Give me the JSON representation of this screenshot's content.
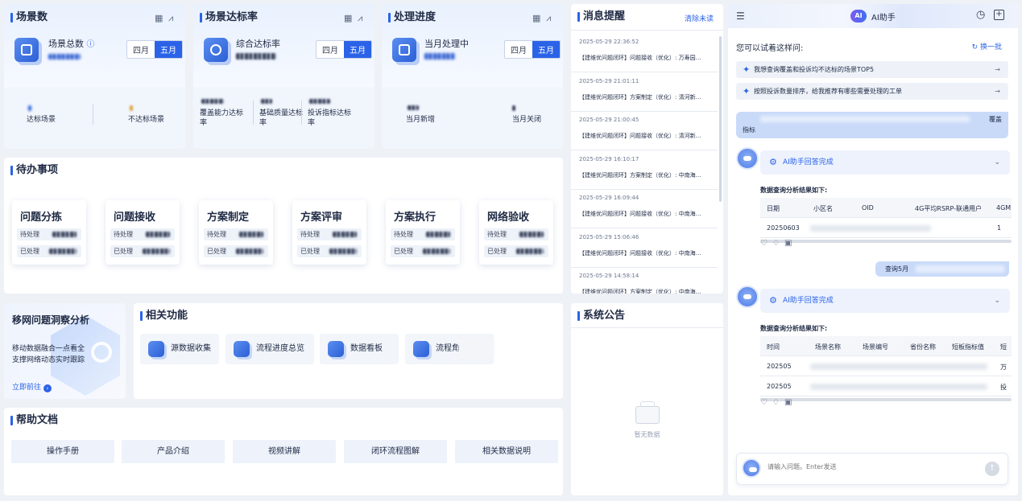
{
  "cards": {
    "scene": {
      "title": "场景数",
      "label": "场景总数",
      "help_icon": "question-circle-icon",
      "toggle": [
        "四月",
        "五月"
      ],
      "active": 1,
      "stats": [
        "达标场景",
        "不达标场景"
      ]
    },
    "rate": {
      "title": "场景达标率",
      "label": "综合达标率",
      "toggle": [
        "四月",
        "五月"
      ],
      "active": 1,
      "stats": [
        "覆盖能力达标率",
        "基础质量达标率",
        "投诉指标达标率"
      ]
    },
    "progress": {
      "title": "处理进度",
      "label": "当月处理中",
      "toggle": [
        "四月",
        "五月"
      ],
      "active": 1,
      "stats": [
        "当月新增",
        "当月关闭"
      ]
    }
  },
  "header_icons": [
    "grid-icon",
    "line-chart-icon"
  ],
  "todo": {
    "title": "待办事项",
    "pending": "待处理",
    "done": "已处理",
    "items": [
      "问题分拣",
      "问题接收",
      "方案制定",
      "方案评审",
      "方案执行",
      "网络验收"
    ]
  },
  "insight": {
    "title": "移网问题洞察分析",
    "desc1": "移动数据融合一点看全",
    "desc2": "支撑网络动态实时跟踪",
    "link": "立即前往"
  },
  "functions": {
    "title": "相关功能",
    "items": [
      "源数据收集",
      "流程进度总览",
      "数据看板",
      "流程角"
    ]
  },
  "help": {
    "title": "帮助文档",
    "items": [
      "操作手册",
      "产品介绍",
      "视频讲解",
      "闭环流程图解",
      "相关数据说明"
    ]
  },
  "messages": {
    "title": "消息提醒",
    "clear": "清除未读",
    "items": [
      {
        "time": "2025-05-29 22:36:52",
        "text": "【建维优问题闭环】问题接收（优化）: 万寿园…"
      },
      {
        "time": "2025-05-29 21:01:11",
        "text": "【建维优问题闭环】方案制定（优化）: 清河新…"
      },
      {
        "time": "2025-05-29 21:00:45",
        "text": "【建维优问题闭环】问题接收（优化）: 清河新…"
      },
      {
        "time": "2025-05-29 16:10:17",
        "text": "【建维优问题闭环】方案制定（优化）: 中南海…"
      },
      {
        "time": "2025-05-29 16:09:44",
        "text": "【建维优问题闭环】问题接收（优化）: 中南海…"
      },
      {
        "time": "2025-05-29 15:06:46",
        "text": "【建维优问题闭环】问题接收（优化）: 中南海…"
      },
      {
        "time": "2025-05-29 14:58:14",
        "text": "【建维优问题闭环】方案制定（优化）: 中南海…"
      }
    ]
  },
  "announcement": {
    "title": "系统公告",
    "empty": "暂无数据"
  },
  "assistant": {
    "title": "AI助手",
    "logo_text": "AI",
    "header_icons": [
      "menu-icon",
      "history-icon",
      "new-chat-icon"
    ],
    "try_label": "您可以试着这样问:",
    "refresh": "换一批",
    "suggestions": [
      "我想查询覆盖和投诉均不达标的场景TOP5",
      "按照投诉数量排序，给我推荐有哪些需要处理的工单"
    ],
    "user_msg1_end": "覆盖",
    "user_msg1_line2": "指标",
    "answer_status": "AI助手回答完成",
    "result_caption": "数据查询分析结果如下:",
    "table1": {
      "headers": [
        "日期",
        "小区名",
        "OID",
        "4G平均RSRP-联通用户",
        "4GM"
      ],
      "row": [
        "20250603",
        "",
        "",
        "",
        "1"
      ]
    },
    "user_msg2": "查询5月",
    "table2": {
      "headers": [
        "时间",
        "场景名称",
        "场景编号",
        "省份名称",
        "短板指标值",
        "短"
      ],
      "rows": [
        [
          "202505",
          "",
          "",
          "",
          "",
          "万"
        ],
        [
          "202505",
          "",
          "",
          "",
          "",
          "投"
        ]
      ]
    },
    "feedback_icons": [
      "thumb-up-icon",
      "thumb-down-icon",
      "copy-icon"
    ],
    "input_placeholder": "请输入问题。Enter发送"
  }
}
